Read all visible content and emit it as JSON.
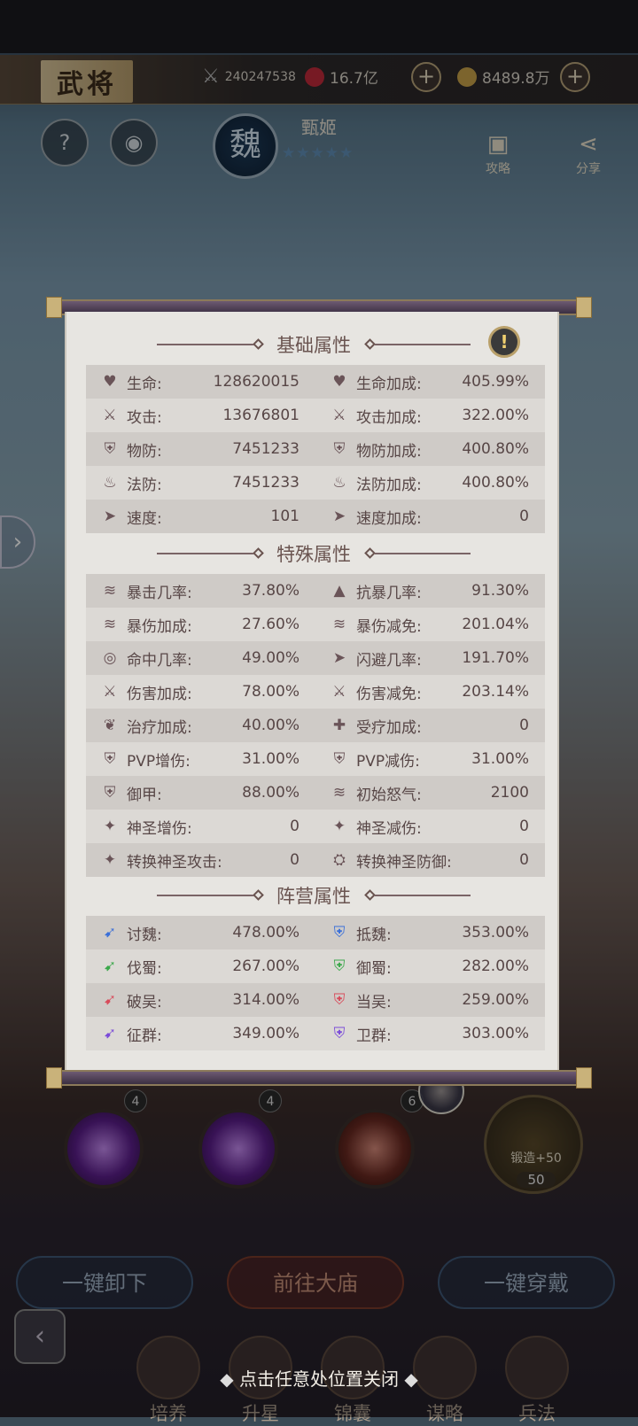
{
  "header": {
    "title": "武将",
    "power": "240247538",
    "ruby": "16.7亿",
    "gold": "8489.8万"
  },
  "hero": {
    "faction_glyph": "魏",
    "name": "甄姬",
    "stars": "★★★★★",
    "guide_label": "攻略",
    "share_label": "分享"
  },
  "panel": {
    "basic_title": "基础属性",
    "special_title": "特殊属性",
    "faction_title": "阵营属性",
    "basic_rows": [
      {
        "l_label": "生命:",
        "l_val": "128620015",
        "r_label": "生命加成:",
        "r_val": "405.99%"
      },
      {
        "l_label": "攻击:",
        "l_val": "13676801",
        "r_label": "攻击加成:",
        "r_val": "322.00%"
      },
      {
        "l_label": "物防:",
        "l_val": "7451233",
        "r_label": "物防加成:",
        "r_val": "400.80%"
      },
      {
        "l_label": "法防:",
        "l_val": "7451233",
        "r_label": "法防加成:",
        "r_val": "400.80%"
      },
      {
        "l_label": "速度:",
        "l_val": "101",
        "r_label": "速度加成:",
        "r_val": "0"
      }
    ],
    "special_rows": [
      {
        "l_label": "暴击几率:",
        "l_val": "37.80%",
        "r_label": "抗暴几率:",
        "r_val": "91.30%"
      },
      {
        "l_label": "暴伤加成:",
        "l_val": "27.60%",
        "r_label": "暴伤减免:",
        "r_val": "201.04%"
      },
      {
        "l_label": "命中几率:",
        "l_val": "49.00%",
        "r_label": "闪避几率:",
        "r_val": "191.70%"
      },
      {
        "l_label": "伤害加成:",
        "l_val": "78.00%",
        "r_label": "伤害减免:",
        "r_val": "203.14%"
      },
      {
        "l_label": "治疗加成:",
        "l_val": "40.00%",
        "r_label": "受疗加成:",
        "r_val": "0"
      },
      {
        "l_label": "PVP增伤:",
        "l_val": "31.00%",
        "r_label": "PVP减伤:",
        "r_val": "31.00%"
      },
      {
        "l_label": "御甲:",
        "l_val": "88.00%",
        "r_label": "初始怒气:",
        "r_val": "2100"
      },
      {
        "l_label": "神圣增伤:",
        "l_val": "0",
        "r_label": "神圣减伤:",
        "r_val": "0"
      },
      {
        "l_label": "转换神圣攻击:",
        "l_val": "0",
        "r_label": "转换神圣防御:",
        "r_val": "0"
      }
    ],
    "faction_rows": [
      {
        "l_label": "讨魏:",
        "l_val": "478.00%",
        "r_label": "抵魏:",
        "r_val": "353.00%"
      },
      {
        "l_label": "伐蜀:",
        "l_val": "267.00%",
        "r_label": "御蜀:",
        "r_val": "282.00%"
      },
      {
        "l_label": "破吴:",
        "l_val": "314.00%",
        "r_label": "当吴:",
        "r_val": "259.00%"
      },
      {
        "l_label": "征群:",
        "l_val": "349.00%",
        "r_label": "卫群:",
        "r_val": "303.00%"
      }
    ]
  },
  "skills": {
    "count1": "4",
    "count2": "4",
    "count3": "6",
    "forge_label": "锻造+50",
    "forge_level": "50"
  },
  "buttons": {
    "unequip_all": "一键卸下",
    "go_temple": "前往大庙",
    "equip_all": "一键穿戴"
  },
  "close_tip": "点击任意处位置关闭",
  "nav": [
    "培养",
    "升星",
    "锦囊",
    "谋略",
    "兵法"
  ],
  "colors": {
    "wei": "#3a6fd8",
    "shu": "#3aa84a",
    "wu": "#d84a5a",
    "qun": "#7a4ad8"
  }
}
